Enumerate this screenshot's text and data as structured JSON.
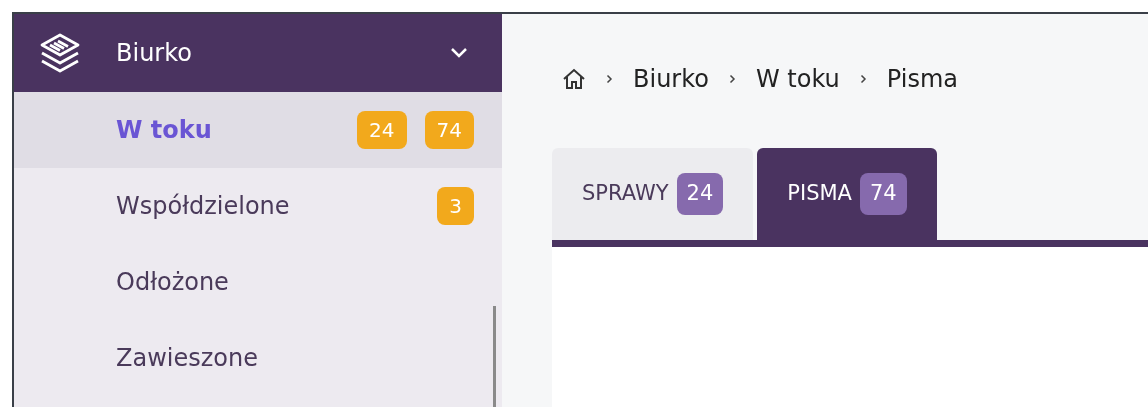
{
  "sidebar": {
    "section": {
      "title": "Biurko",
      "expanded": true
    },
    "items": [
      {
        "label": "W toku",
        "selected": true,
        "badges": [
          "24",
          "74"
        ]
      },
      {
        "label": "Współdzielone",
        "selected": false,
        "badges": [
          "3"
        ]
      },
      {
        "label": "Odłożone",
        "selected": false
      },
      {
        "label": "Zawieszone",
        "selected": false
      }
    ]
  },
  "breadcrumb": [
    "Biurko",
    "W toku",
    "Pisma"
  ],
  "tabs": [
    {
      "label": "SPRAWY",
      "count": "24",
      "selected": false
    },
    {
      "label": "PISMA",
      "count": "74",
      "selected": true
    }
  ]
}
